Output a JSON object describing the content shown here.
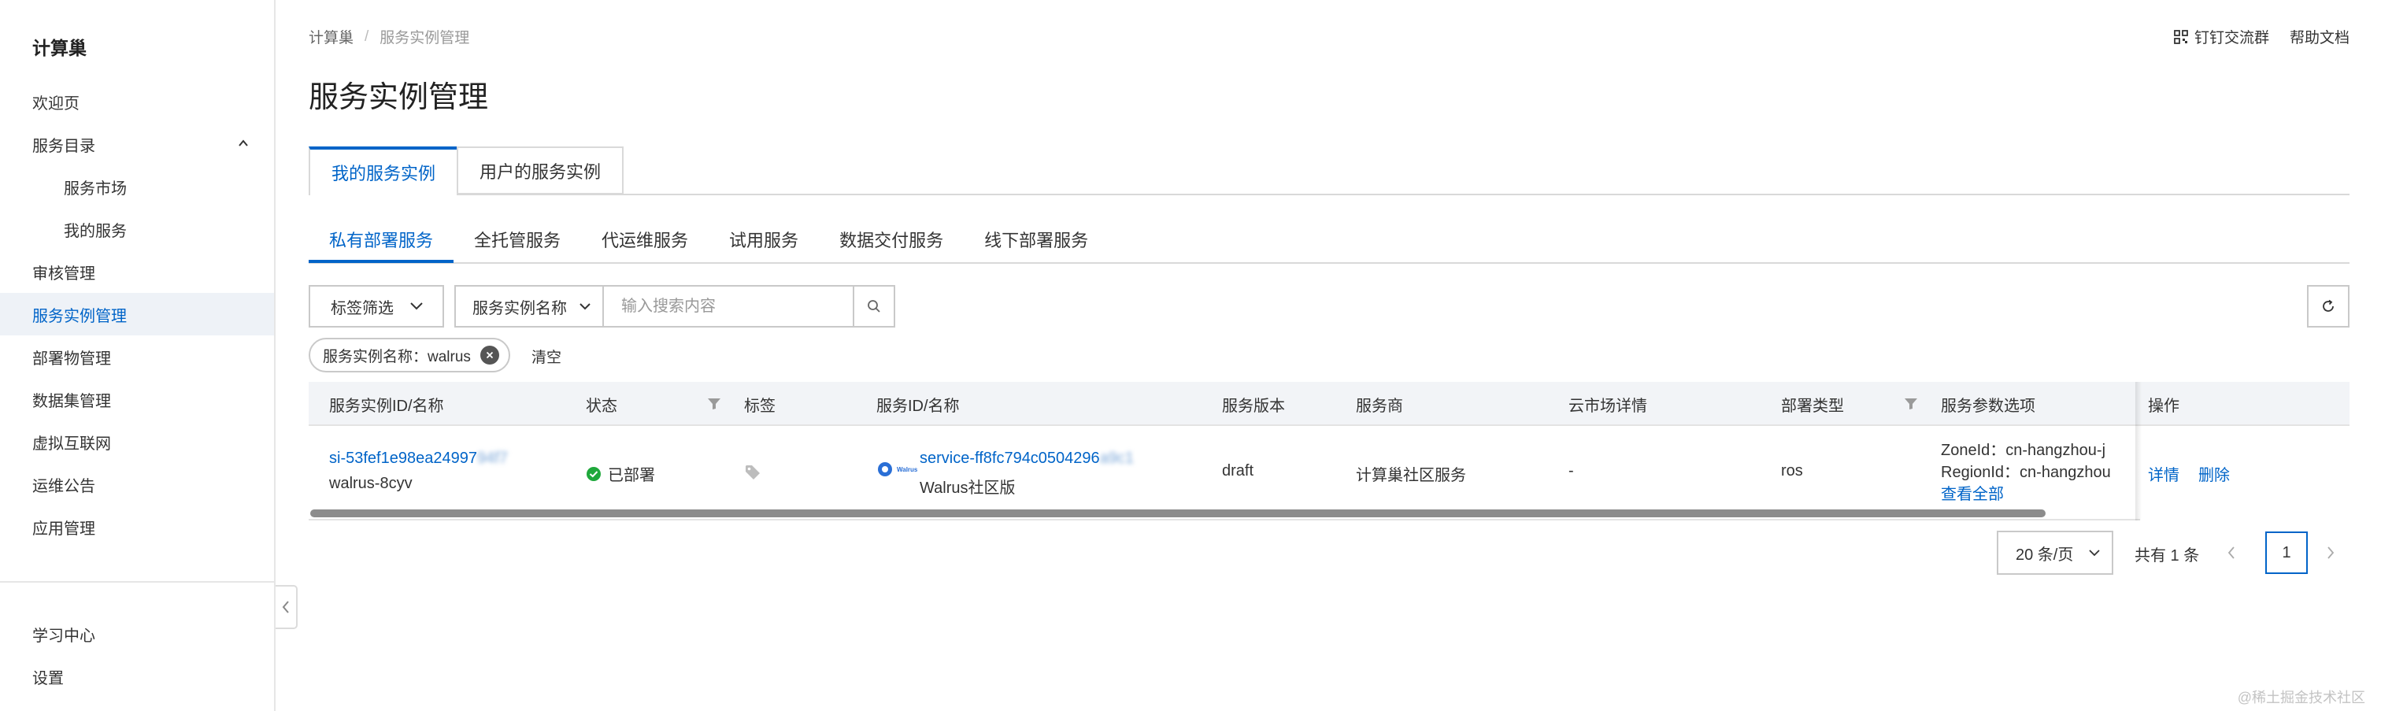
{
  "sidebar": {
    "title": "计算巢",
    "items": [
      {
        "label": "欢迎页"
      },
      {
        "label": "服务目录"
      },
      {
        "label": "服务市场"
      },
      {
        "label": "我的服务"
      },
      {
        "label": "审核管理"
      },
      {
        "label": "服务实例管理"
      },
      {
        "label": "部署物管理"
      },
      {
        "label": "数据集管理"
      },
      {
        "label": "虚拟互联网"
      },
      {
        "label": "运维公告"
      },
      {
        "label": "应用管理"
      }
    ],
    "bottom_items": [
      {
        "label": "学习中心"
      },
      {
        "label": "设置"
      }
    ]
  },
  "header": {
    "breadcrumb": [
      "计算巢",
      "服务实例管理"
    ],
    "links": {
      "dingtalk": "钉钉交流群",
      "help": "帮助文档"
    },
    "title": "服务实例管理"
  },
  "tabs_primary": [
    {
      "label": "我的服务实例"
    },
    {
      "label": "用户的服务实例"
    }
  ],
  "tabs_secondary": [
    {
      "label": "私有部署服务"
    },
    {
      "label": "全托管服务"
    },
    {
      "label": "代运维服务"
    },
    {
      "label": "试用服务"
    },
    {
      "label": "数据交付服务"
    },
    {
      "label": "线下部署服务"
    }
  ],
  "filters": {
    "tag_filter": "标签筛选",
    "search_field": "服务实例名称",
    "search_placeholder": "输入搜索内容",
    "chip_label": "服务实例名称：walrus",
    "clear": "清空"
  },
  "table": {
    "columns": [
      "服务实例ID/名称",
      "状态",
      "标签",
      "服务ID/名称",
      "服务版本",
      "服务商",
      "云市场详情",
      "部署类型",
      "服务参数选项",
      "操作"
    ],
    "rows": [
      {
        "instance_id": "si-53fef1e98ea24997",
        "instance_id_blurred": "94f7",
        "instance_name": "walrus-8cyv",
        "status": "已部署",
        "service_logo": "Walrus",
        "service_id": "service-ff8fc794c0504296",
        "service_id_blurred": "a9c1",
        "service_name": "Walrus社区版",
        "version": "draft",
        "provider": "计算巢社区服务",
        "market": "-",
        "deploy_type": "ros",
        "param_zone": "ZoneId：cn-hangzhou-j",
        "param_region": "RegionId：cn-hangzhou",
        "param_more": "查看全部",
        "op_detail": "详情",
        "op_delete": "删除"
      }
    ]
  },
  "pagination": {
    "page_size": "20 条/页",
    "total": "共有 1 条",
    "current": "1"
  },
  "watermark": "@稀土掘金技术社区",
  "colors": {
    "primary": "#0064c8",
    "success": "#1fa83b",
    "border": "#c9c9c9"
  }
}
